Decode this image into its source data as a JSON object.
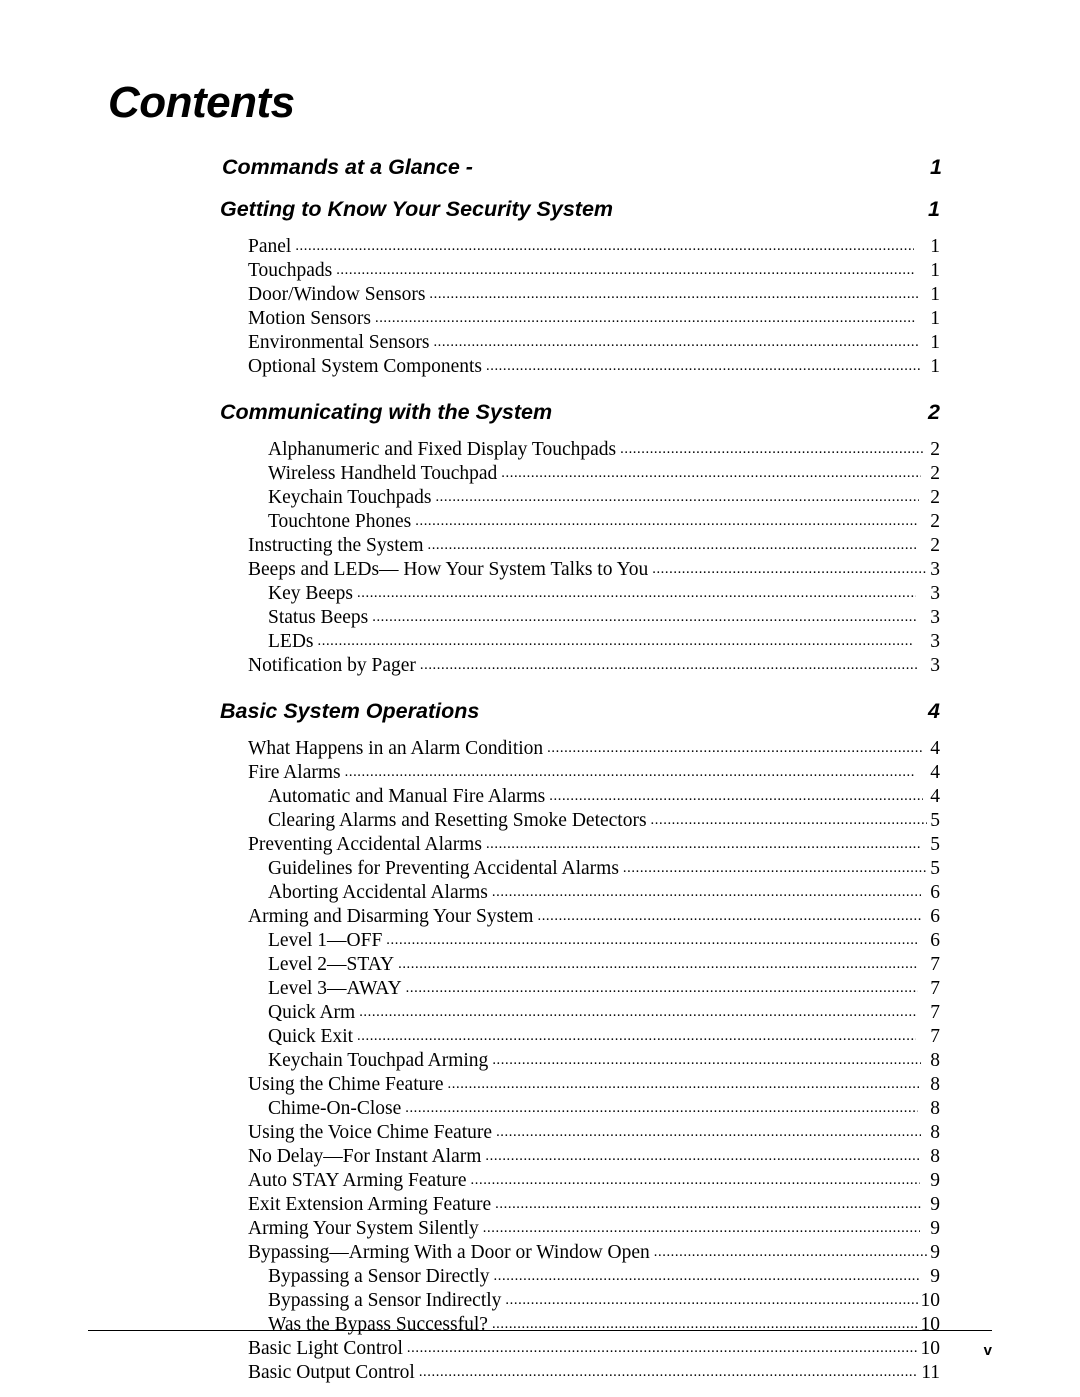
{
  "document": {
    "page_title": "Contents",
    "folio": "v"
  },
  "toc": {
    "dot_leader": "..................................................................................................................................................................",
    "entries": [
      {
        "level": 0,
        "label": "Commands at a Glance -",
        "page": "1",
        "gap_before": 0
      },
      {
        "level": 0,
        "label": "Getting to Know Your Security System",
        "page": "1",
        "gap_before": 17
      },
      {
        "level": 1,
        "label": "Panel",
        "page": "1",
        "gap_before": 12
      },
      {
        "level": 1,
        "label": "Touchpads",
        "page": "1",
        "gap_before": 0
      },
      {
        "level": 1,
        "label": "Door/Window Sensors",
        "page": "1",
        "gap_before": 0
      },
      {
        "level": 1,
        "label": "Motion Sensors",
        "page": "1",
        "gap_before": 0
      },
      {
        "level": 1,
        "label": "Environmental Sensors",
        "page": "1",
        "gap_before": 0
      },
      {
        "level": 1,
        "label": "Optional System Components",
        "page": "1",
        "gap_before": 0
      },
      {
        "level": 0,
        "label": "Communicating with the System",
        "page": "2",
        "gap_before": 22
      },
      {
        "level": 2,
        "label": "Alphanumeric and Fixed Display Touchpads",
        "page": "2",
        "gap_before": 12
      },
      {
        "level": 2,
        "label": "Wireless Handheld Touchpad",
        "page": "2",
        "gap_before": 0
      },
      {
        "level": 2,
        "label": "Keychain Touchpads",
        "page": "2",
        "gap_before": 0
      },
      {
        "level": 2,
        "label": "Touchtone Phones",
        "page": "2",
        "gap_before": 0
      },
      {
        "level": 1,
        "label": "Instructing the System",
        "page": "2",
        "gap_before": 0
      },
      {
        "level": 1,
        "label": "Beeps and LEDs— How Your System Talks to You",
        "page": "3",
        "gap_before": 0
      },
      {
        "level": 2,
        "label": "Key Beeps",
        "page": "3",
        "gap_before": 0
      },
      {
        "level": 2,
        "label": "Status Beeps",
        "page": "3",
        "gap_before": 0
      },
      {
        "level": 2,
        "label": "LEDs",
        "page": "3",
        "gap_before": 0
      },
      {
        "level": 1,
        "label": "Notification by Pager",
        "page": "3",
        "gap_before": 0
      },
      {
        "level": 0,
        "label": "Basic System Operations",
        "page": "4",
        "gap_before": 22
      },
      {
        "level": 1,
        "label": "What Happens in an Alarm Condition",
        "page": "4",
        "gap_before": 12
      },
      {
        "level": 1,
        "label": "Fire Alarms",
        "page": "4",
        "gap_before": 0
      },
      {
        "level": 2,
        "label": "Automatic and Manual Fire Alarms",
        "page": "4",
        "gap_before": 0
      },
      {
        "level": 2,
        "label": "Clearing Alarms and Resetting Smoke Detectors",
        "page": "5",
        "gap_before": 0
      },
      {
        "level": 1,
        "label": "Preventing Accidental Alarms",
        "page": "5",
        "gap_before": 0
      },
      {
        "level": 2,
        "label": "Guidelines for Preventing Accidental Alarms",
        "page": "5",
        "gap_before": 0
      },
      {
        "level": 2,
        "label": "Aborting Accidental Alarms",
        "page": "6",
        "gap_before": 0
      },
      {
        "level": 1,
        "label": "Arming and Disarming Your System",
        "page": "6",
        "gap_before": 0
      },
      {
        "level": 2,
        "label": "Level 1—OFF",
        "page": "6",
        "gap_before": 0
      },
      {
        "level": 2,
        "label": "Level 2—STAY",
        "page": "7",
        "gap_before": 0
      },
      {
        "level": 2,
        "label": "Level 3—AWAY",
        "page": "7",
        "gap_before": 0
      },
      {
        "level": 2,
        "label": "Quick Arm",
        "page": "7",
        "gap_before": 0
      },
      {
        "level": 2,
        "label": "Quick Exit",
        "page": "7",
        "gap_before": 0
      },
      {
        "level": 2,
        "label": "Keychain Touchpad Arming",
        "page": "8",
        "gap_before": 0
      },
      {
        "level": 1,
        "label": "Using the Chime Feature",
        "page": "8",
        "gap_before": 0
      },
      {
        "level": 2,
        "label": "Chime-On-Close",
        "page": "8",
        "gap_before": 0
      },
      {
        "level": 1,
        "label": "Using the Voice Chime Feature",
        "page": "8",
        "gap_before": 0
      },
      {
        "level": 1,
        "label": "No Delay—For Instant Alarm",
        "page": "8",
        "gap_before": 0
      },
      {
        "level": 1,
        "label": "Auto STAY Arming Feature",
        "page": "9",
        "gap_before": 0
      },
      {
        "level": 1,
        "label": "Exit Extension Arming Feature",
        "page": "9",
        "gap_before": 0
      },
      {
        "level": 1,
        "label": "Arming Your System Silently",
        "page": "9",
        "gap_before": 0
      },
      {
        "level": 1,
        "label": "Bypassing—Arming With a Door or Window Open",
        "page": "9",
        "gap_before": 0
      },
      {
        "level": 2,
        "label": "Bypassing a Sensor Directly",
        "page": "9",
        "gap_before": 0
      },
      {
        "level": 2,
        "label": "Bypassing a Sensor Indirectly",
        "page": "10",
        "gap_before": 0
      },
      {
        "level": 2,
        "label": "Was the Bypass Successful?",
        "page": "10",
        "gap_before": 0
      },
      {
        "level": 1,
        "label": "Basic Light Control",
        "page": "10",
        "gap_before": 0
      },
      {
        "level": 1,
        "label": "Basic Output Control",
        "page": "11",
        "gap_before": 0
      }
    ]
  }
}
